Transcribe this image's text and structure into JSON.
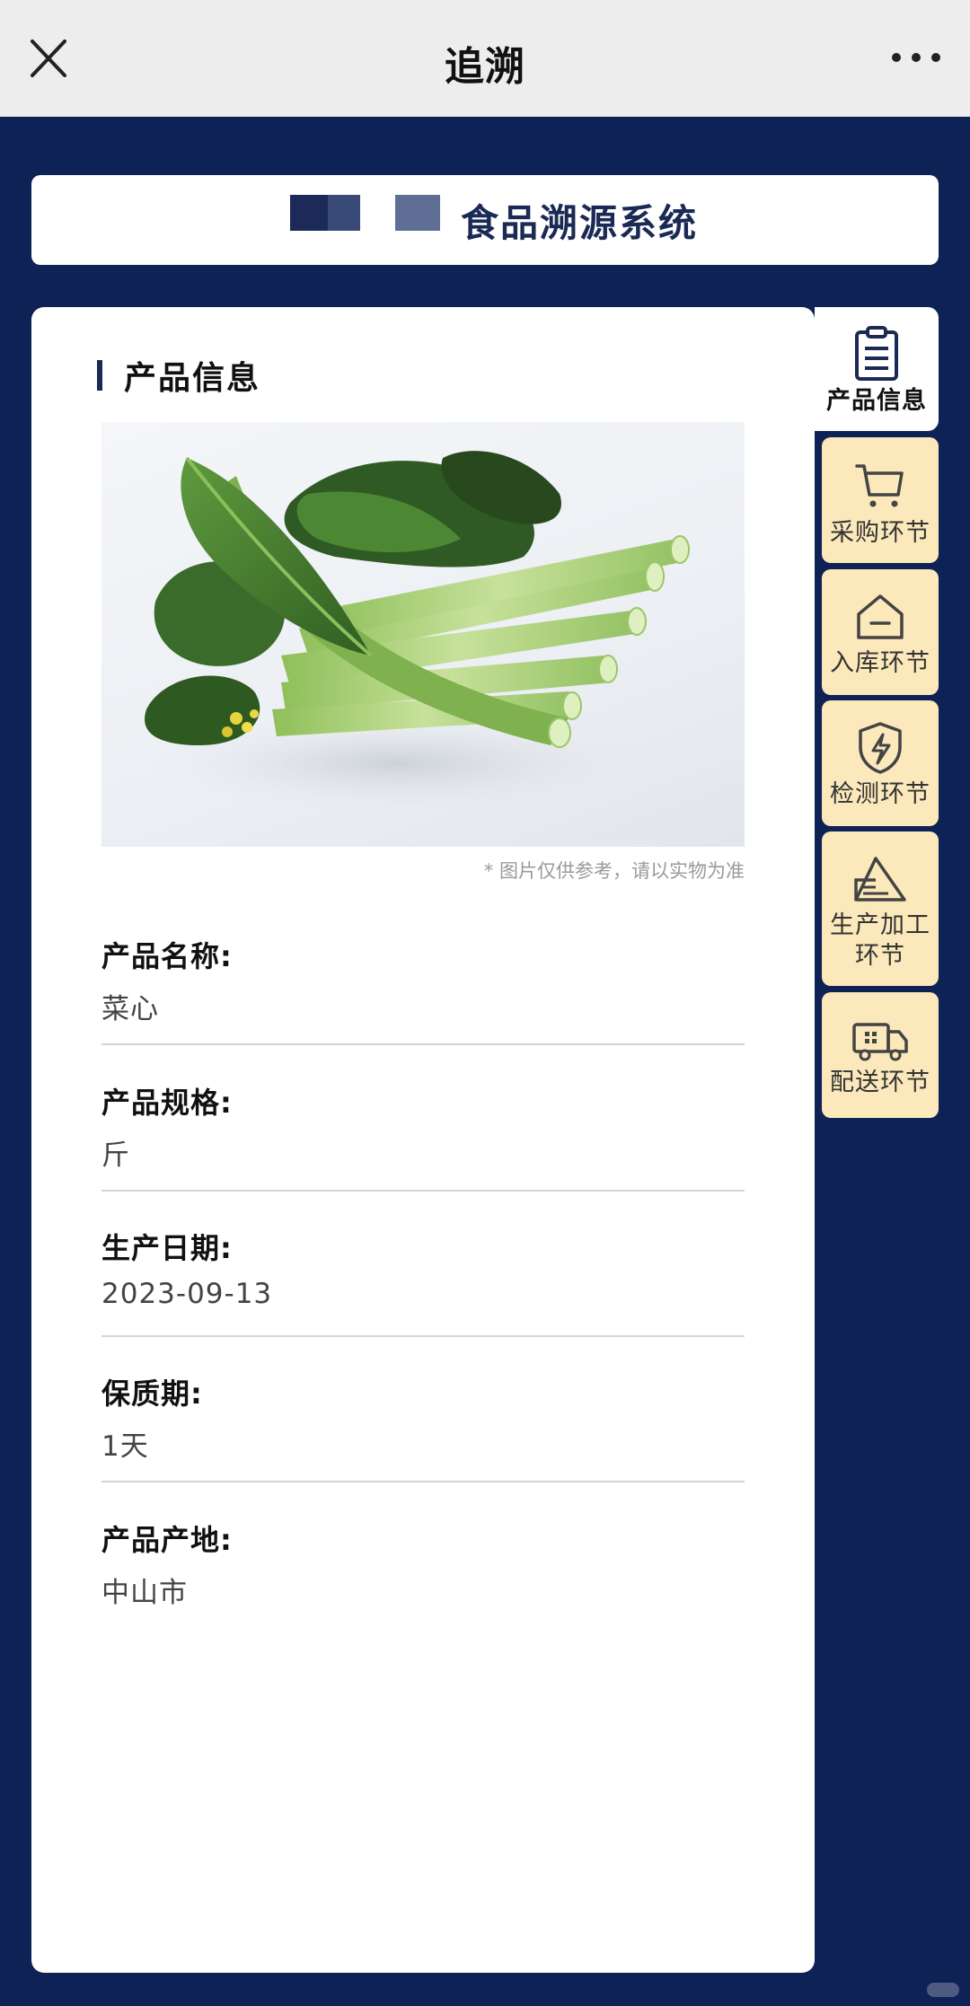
{
  "topbar": {
    "title": "追溯"
  },
  "banner": {
    "title_visible": "食品溯源系统"
  },
  "section": {
    "title": "产品信息"
  },
  "photo": {
    "note": "* 图片仅供参考，请以实物为准"
  },
  "fields": [
    {
      "label": "产品名称:",
      "value": "菜心"
    },
    {
      "label": "产品规格:",
      "value": "斤"
    },
    {
      "label": "生产日期:",
      "value": "2023-09-13"
    },
    {
      "label": "保质期:",
      "value": "1天"
    },
    {
      "label": "产品产地:",
      "value": "中山市"
    }
  ],
  "sidebar": {
    "tabs": [
      {
        "label": "产品信息",
        "icon": "clipboard-icon",
        "active": true
      },
      {
        "label": "采购环节",
        "icon": "cart-icon"
      },
      {
        "label": "入库环节",
        "icon": "warehouse-icon"
      },
      {
        "label": "检测环节",
        "icon": "shield-bolt-icon"
      },
      {
        "label_line1": "生产加工",
        "label_line2": "环节",
        "icon": "factory-icon"
      },
      {
        "label": "配送环节",
        "icon": "truck-icon"
      }
    ]
  },
  "colors": {
    "background": "#0f2256",
    "topbar": "#ededed",
    "tab_inactive": "#fbe9bb",
    "accent": "#1b2a55"
  }
}
